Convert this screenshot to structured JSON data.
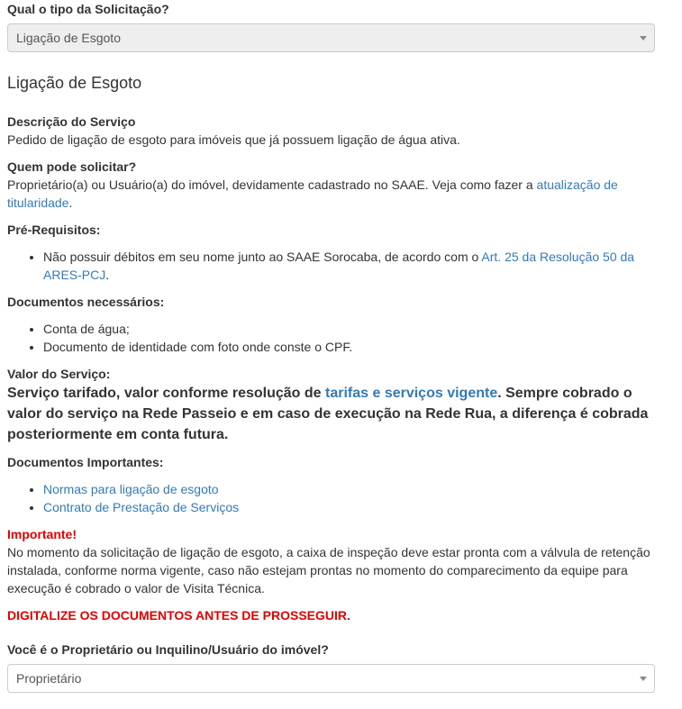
{
  "request_type": {
    "label": "Qual o tipo da Solicitação?",
    "value": "Ligação de Esgoto"
  },
  "service": {
    "title": "Ligação de Esgoto",
    "description_heading": "Descrição do Serviço",
    "description_text": "Pedido de ligação de esgoto para imóveis que já possuem ligação de água ativa.",
    "who_heading": "Quem pode solicitar?",
    "who_text_before": "Proprietário(a) ou Usuário(a) do imóvel, devidamente cadastrado no SAAE. Veja como fazer a ",
    "who_link": "atualização de titularidade",
    "who_text_after": ".",
    "prereq_heading": "Pré-Requisitos:",
    "prereq_text_before": "Não possuir débitos em seu nome junto ao SAAE Sorocaba, de acordo com o ",
    "prereq_link": "Art. 25 da Resolução 50 da ARES-PCJ",
    "prereq_text_after": ".",
    "docs_heading": "Documentos necessários:",
    "docs_items": [
      "Conta de água;",
      "Documento de identidade com foto onde conste o CPF."
    ],
    "value_heading": "Valor do Serviço:",
    "value_text_before": "Serviço tarifado, valor conforme resolução de ",
    "value_link": "tarifas e serviços vigente",
    "value_text_after": ". Sempre cobrado o valor do serviço na Rede Passeio e em caso de execução na Rede Rua, a diferença é cobrada posteriormente em conta futura.",
    "important_docs_heading": "Documentos Importantes:",
    "important_docs_links": [
      "Normas para ligação de esgoto",
      "Contrato de Prestação de Serviços"
    ],
    "important_heading": "Importante!",
    "important_text": "No momento da solicitação de ligação de esgoto, a caixa de inspeção deve estar pronta com a válvula de retenção instalada, conforme norma vigente, caso não estejam prontas no momento do comparecimento da equipe para execução é cobrado o valor de Visita Técnica.",
    "warning": "DIGITALIZE OS DOCUMENTOS ANTES DE PROSSEGUIR."
  },
  "owner_question": {
    "label": "Você é o Proprietário ou Inquilino/Usuário do imóvel?",
    "value": "Proprietário"
  },
  "colors": {
    "link": "#337ab7",
    "warning": "#e00000",
    "disabled_bg": "#eeeeee"
  }
}
